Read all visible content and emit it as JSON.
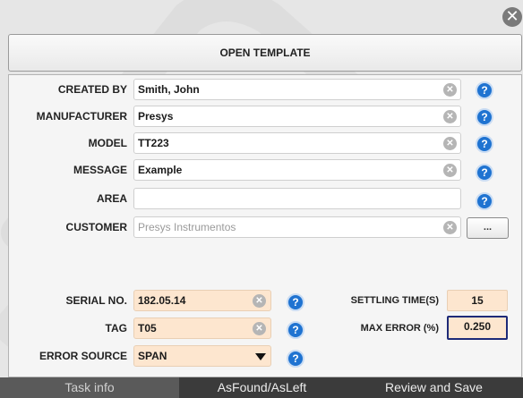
{
  "window": {
    "title": "OPEN TEMPLATE",
    "close_icon": "close-icon"
  },
  "form": {
    "created_by": {
      "label": "CREATED BY",
      "value": "Smith, John"
    },
    "manufacturer": {
      "label": "MANUFACTURER",
      "value": "Presys"
    },
    "model": {
      "label": "MODEL",
      "value": "TT223"
    },
    "message": {
      "label": "MESSAGE",
      "value": "Example"
    },
    "area": {
      "label": "AREA",
      "value": ""
    },
    "customer": {
      "label": "CUSTOMER",
      "placeholder": "Presys Instrumentos",
      "more_label": "..."
    }
  },
  "details": {
    "serial": {
      "label": "SERIAL NO.",
      "value": "182.05.14"
    },
    "tag": {
      "label": "TAG",
      "value": "T05"
    },
    "error_source": {
      "label": "ERROR SOURCE",
      "value": "SPAN"
    },
    "settling": {
      "label": "SETTLING TIME(S)",
      "value": "15"
    },
    "max_error": {
      "label": "MAX ERROR (%)",
      "value": "0.250"
    }
  },
  "tabs": [
    {
      "label": "Task info",
      "active": false
    },
    {
      "label": "AsFound/AsLeft",
      "active": true
    },
    {
      "label": "Review and Save",
      "active": true
    }
  ],
  "icons": {
    "help": "help-icon",
    "clear": "clear-icon",
    "dropdown": "chevron-down-icon"
  },
  "colors": {
    "accent": "#1f73d1",
    "input_highlight": "#fde6cf",
    "active_border": "#1e2a78"
  }
}
